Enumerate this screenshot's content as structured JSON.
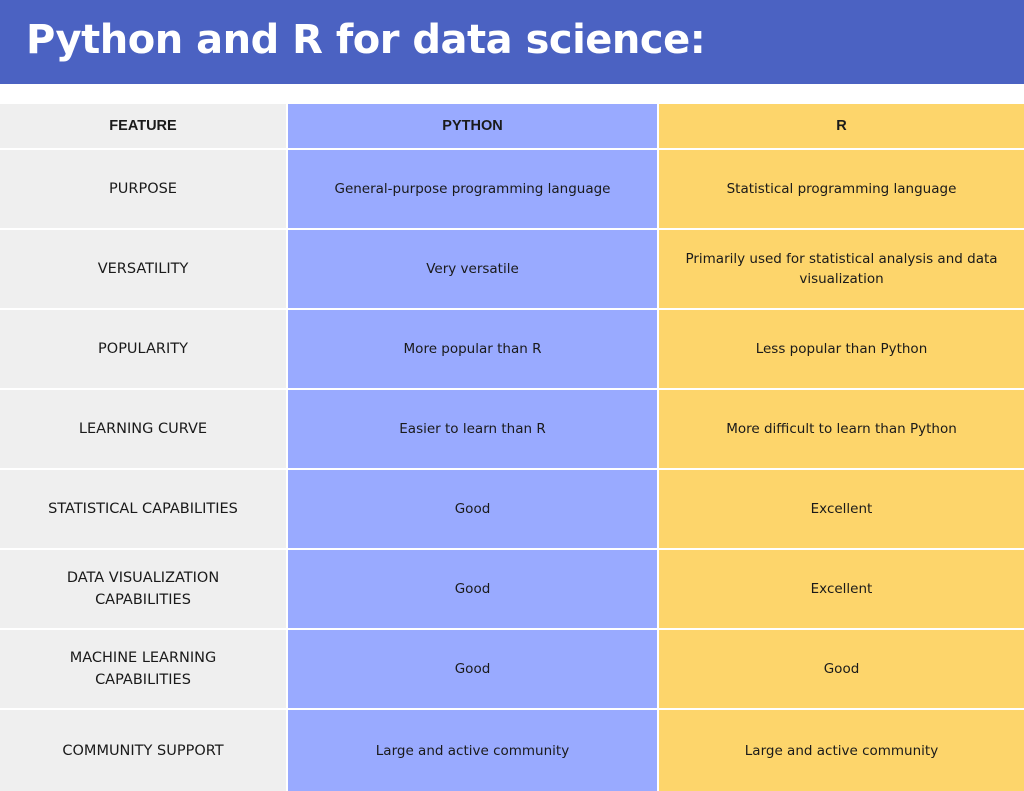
{
  "title": "Python and R for data science:",
  "colors": {
    "banner": "#4b62c2",
    "feature_column": "#efefef",
    "python_column": "#99aaff",
    "r_column": "#fdd56b"
  },
  "table": {
    "headers": [
      "FEATURE",
      "PYTHON",
      "R"
    ],
    "rows": [
      {
        "feature": "PURPOSE",
        "python": "General-purpose programming language",
        "r": "Statistical programming language"
      },
      {
        "feature": "VERSATILITY",
        "python": "Very versatile",
        "r": "Primarily used for statistical analysis and data visualization"
      },
      {
        "feature": "POPULARITY",
        "python": "More popular than R",
        "r": "Less popular than Python"
      },
      {
        "feature": "LEARNING CURVE",
        "python": "Easier to learn than R",
        "r": "More difficult to learn than Python"
      },
      {
        "feature": "STATISTICAL CAPABILITIES",
        "python": "Good",
        "r": "Excellent"
      },
      {
        "feature": "DATA VISUALIZATION CAPABILITIES",
        "python": "Good",
        "r": "Excellent"
      },
      {
        "feature": "MACHINE LEARNING CAPABILITIES",
        "python": "Good",
        "r": "Good"
      },
      {
        "feature": "COMMUNITY SUPPORT",
        "python": "Large and active community",
        "r": "Large and active community"
      }
    ]
  }
}
